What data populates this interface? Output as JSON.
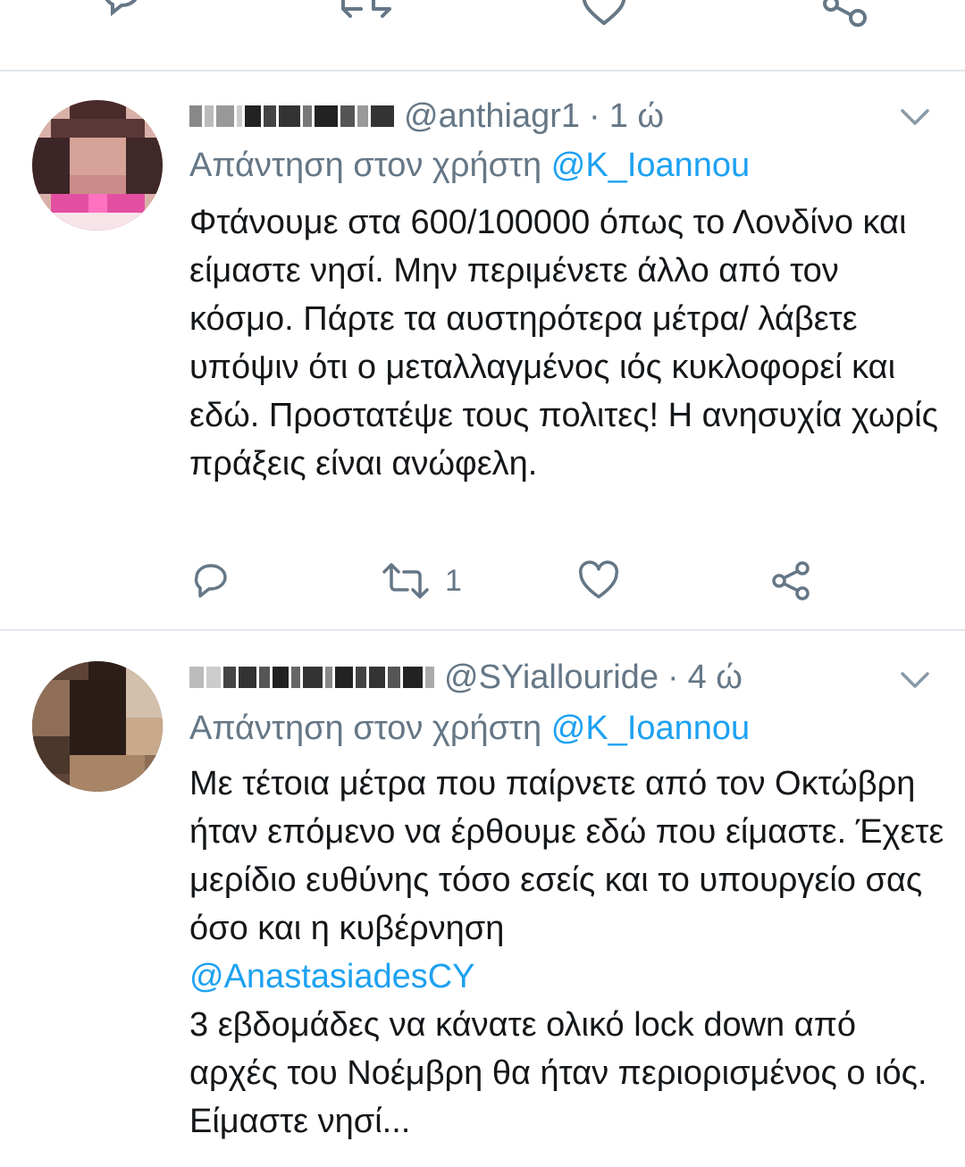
{
  "colors": {
    "text": "#14171a",
    "secondary": "#657786",
    "link": "#1da1f2",
    "divider": "#e1e8ed"
  },
  "top_action_bar": {
    "icons": [
      "reply-icon",
      "retweet-icon",
      "like-icon",
      "share-icon"
    ]
  },
  "tweets": [
    {
      "display_name_hidden": true,
      "handle": "@anthiagr1",
      "separator": "·",
      "time": "1 ώ",
      "reply_prefix": "Απάντηση στον χρήστη",
      "reply_to": "@K_Ioannou",
      "body": [
        "Φτάνουμε στα 600/100000 όπως το Λονδίνο και είμαστε νησί. Μην περιμένετε άλλο από τον κόσμο. Πάρτε τα αυστηρότερα μέτρα/ λάβετε υπόψιν ότι ο μεταλλαγμένος ιός κυκλοφορεί και εδώ. Προστατέψε τους πολιτες! Η ανησυχία χωρίς πράξεις είναι ανώφελη."
      ],
      "actions": {
        "reply_count": "",
        "retweet_count": "1",
        "like_count": ""
      }
    },
    {
      "display_name_hidden": true,
      "handle": "@SYiallouride",
      "separator": "·",
      "time": "4 ώ",
      "reply_prefix": "Απάντηση στον χρήστη",
      "reply_to": "@K_Ioannou",
      "body_before_mention": "Με τέτοια μέτρα που παίρνετε από τον Οκτώβρη ήταν επόμενο να έρθουμε εδώ που είμαστε. Έχετε μερίδιο ευθύνης τόσο εσείς και το υπουργείο σας όσο και η κυβέρνηση",
      "body_mention": "@AnastasiadesCY",
      "body_after_mention": "3 εβδομάδες να κάνατε ολικό lock down από αρχές του Νοέμβρη θα ήταν περιορισμένος ο ιός. Είμαστε νησί..."
    }
  ]
}
